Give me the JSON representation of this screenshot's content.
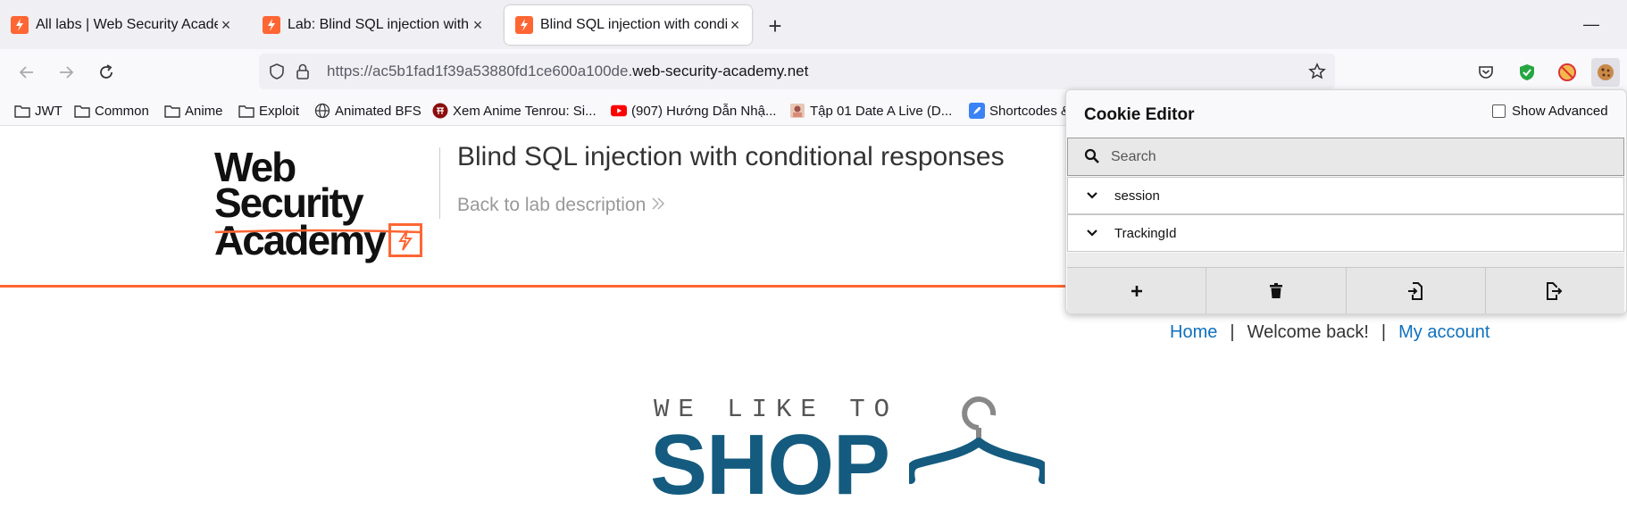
{
  "tabs": [
    {
      "title": "All labs | Web Security Academy",
      "active": false
    },
    {
      "title": "Lab: Blind SQL injection with co",
      "active": false
    },
    {
      "title": "Blind SQL injection with conditio",
      "active": true
    }
  ],
  "toolbar": {
    "url_prefix": "https://ac5b1fad1f39a53880fd1ce600a100de.",
    "url_domain": "web-security-academy.net"
  },
  "bookmarks": [
    {
      "label": "JWT",
      "icon": "folder-icon"
    },
    {
      "label": "Common",
      "icon": "folder-icon"
    },
    {
      "label": "Anime",
      "icon": "folder-icon"
    },
    {
      "label": "Exploit",
      "icon": "folder-icon"
    },
    {
      "label": "Animated BFS",
      "icon": "globe-icon"
    },
    {
      "label": "Xem Anime Tenrou: Si...",
      "icon": "site-favicon"
    },
    {
      "label": "(907) Hướng Dẫn Nhậ...",
      "icon": "youtube-icon"
    },
    {
      "label": "Tập 01 Date A Live (D...",
      "icon": "site-favicon"
    },
    {
      "label": "Shortcodes &",
      "icon": "rocket-icon"
    }
  ],
  "page": {
    "logo_line1": "Web Security",
    "logo_line2": "Academy",
    "lab_title": "Blind SQL injection with conditional responses",
    "back_link": "Back to lab description",
    "nav_home": "Home",
    "nav_sep": "|",
    "nav_welcome": "Welcome back!",
    "nav_account": "My account",
    "shop_tagline": "WE LIKE TO",
    "shop_word": "SHOP"
  },
  "cookie_editor": {
    "title": "Cookie Editor",
    "show_advanced": "Show Advanced",
    "show_advanced_checked": false,
    "search_placeholder": "Search",
    "cookies": [
      "session",
      "TrackingId"
    ],
    "actions": [
      "add-icon",
      "trash-icon",
      "import-icon",
      "export-icon"
    ]
  },
  "colors": {
    "accent_orange": "#ff6633",
    "link_blue": "#0f71be",
    "shop_blue": "#145b7f"
  }
}
